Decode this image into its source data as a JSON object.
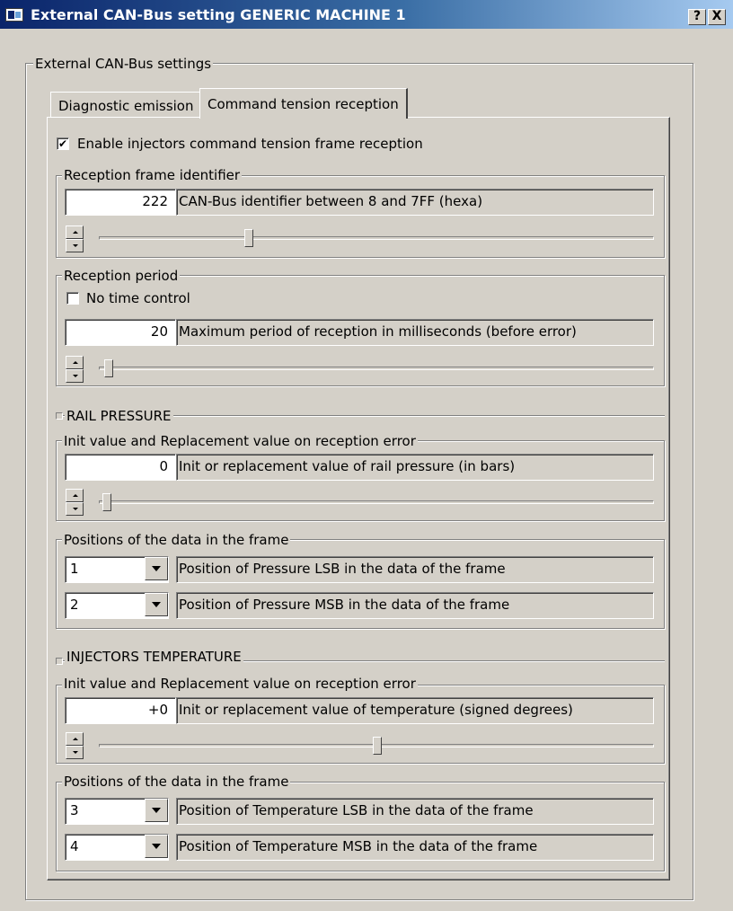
{
  "window": {
    "title": "External CAN-Bus setting GENERIC MACHINE 1",
    "help_button": "?",
    "close_button": "X"
  },
  "main_group": {
    "label": "External CAN-Bus settings"
  },
  "tabs": [
    {
      "label": "Diagnostic emission",
      "active": false
    },
    {
      "label": "Command tension reception",
      "active": true
    }
  ],
  "enable_reception": {
    "label": "Enable injectors command tension frame reception",
    "checked": true
  },
  "reception_frame": {
    "group_label": "Reception frame identifier",
    "value": "222",
    "description": "CAN-Bus identifier between 8 and 7FF (hexa)",
    "slider_fraction": 0.27
  },
  "reception_period": {
    "group_label": "Reception period",
    "no_time_control": {
      "label": "No time control",
      "checked": false
    },
    "value": "20",
    "description": "Maximum period of reception in milliseconds (before error)",
    "slider_fraction": 0.0
  },
  "rail_pressure": {
    "section_label": "RAIL PRESSURE",
    "init_group_label": "Init value and Replacement value on reception error",
    "value": "0",
    "description": "Init or replacement value of rail pressure (in bars)",
    "slider_fraction": 0.0,
    "positions_group_label": "Positions of the data in the frame",
    "positions": [
      {
        "value": "1",
        "description": "Position of Pressure LSB in the data of the frame"
      },
      {
        "value": "2",
        "description": "Position of Pressure MSB in the data of the frame"
      }
    ]
  },
  "injectors_temperature": {
    "section_label": "INJECTORS TEMPERATURE",
    "init_group_label": "Init value and Replacement value on reception error",
    "value": "+0",
    "description": "Init or replacement value of temperature (signed degrees)",
    "slider_fraction": 0.5,
    "positions_group_label": "Positions of the data in the frame",
    "positions": [
      {
        "value": "3",
        "description": "Position of Temperature LSB in the data of the frame"
      },
      {
        "value": "4",
        "description": "Position of Temperature MSB in the data of the frame"
      }
    ]
  }
}
